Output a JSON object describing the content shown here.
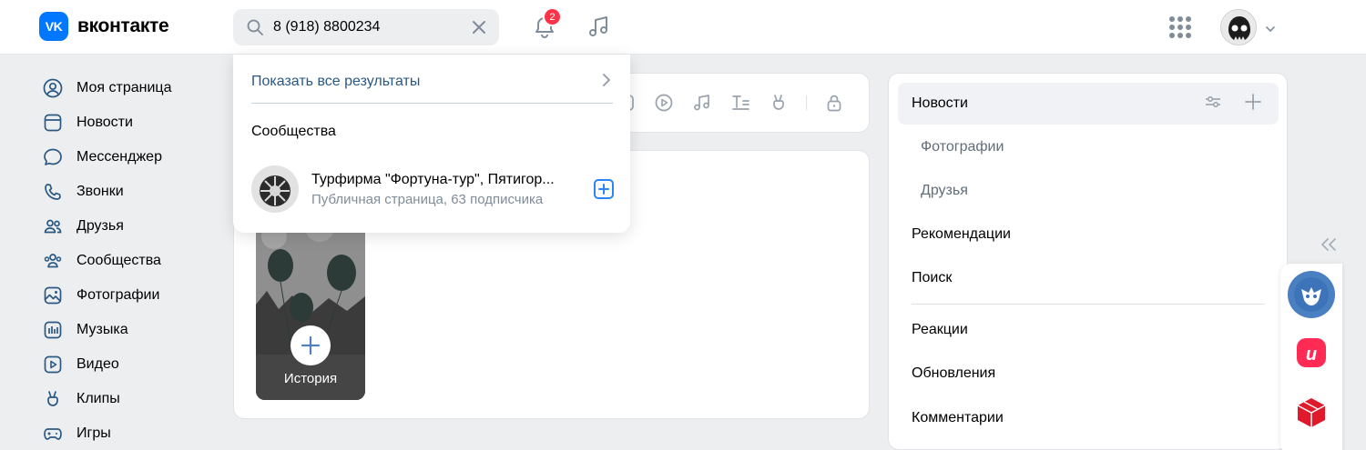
{
  "header": {
    "logo_mark": "VK",
    "logo_text": "вконтакте",
    "search_value": "8 (918) 8800234",
    "notifications_count": "2"
  },
  "nav": {
    "items": [
      {
        "label": "Моя страница",
        "icon": "user-circle-icon"
      },
      {
        "label": "Новости",
        "icon": "newsfeed-icon"
      },
      {
        "label": "Мессенджер",
        "icon": "message-icon"
      },
      {
        "label": "Звонки",
        "icon": "phone-icon"
      },
      {
        "label": "Друзья",
        "icon": "friends-icon"
      },
      {
        "label": "Сообщества",
        "icon": "communities-icon"
      },
      {
        "label": "Фотографии",
        "icon": "photo-icon"
      },
      {
        "label": "Музыка",
        "icon": "music-icon"
      },
      {
        "label": "Видео",
        "icon": "video-icon"
      },
      {
        "label": "Клипы",
        "icon": "clips-icon"
      },
      {
        "label": "Игры",
        "icon": "games-icon"
      }
    ]
  },
  "dropdown": {
    "show_all_label": "Показать все результаты",
    "section_title": "Сообщества",
    "result": {
      "title": "Турфирма \"Фортуна-тур\", Пятигор...",
      "subtitle": "Публичная страница, 63 подписчика"
    }
  },
  "stories": {
    "add_label": "История"
  },
  "right": {
    "items": [
      {
        "label": "Новости",
        "active": true
      },
      {
        "label": "Фотографии",
        "sub": true
      },
      {
        "label": "Друзья",
        "sub": true
      },
      {
        "label": "Рекомендации"
      },
      {
        "label": "Поиск"
      },
      {
        "label": "Реакции"
      },
      {
        "label": "Обновления"
      },
      {
        "label": "Комментарии"
      }
    ]
  },
  "colors": {
    "brand": "#0077ff",
    "link": "#2a5885",
    "badge": "#ff3347",
    "background": "#edeef0"
  }
}
